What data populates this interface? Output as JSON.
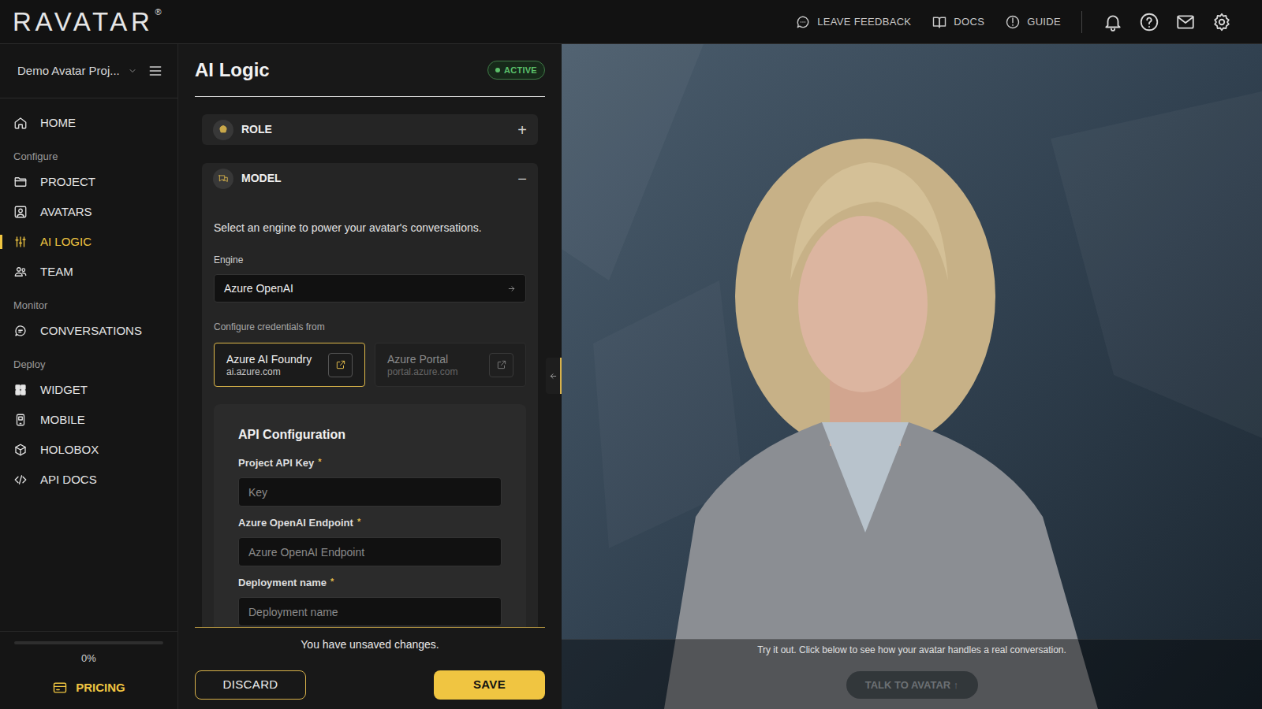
{
  "logo": {
    "text": "RAVATAR",
    "mark": "®"
  },
  "top_bar": {
    "links": [
      {
        "label": "LEAVE FEEDBACK"
      },
      {
        "label": "DOCS"
      },
      {
        "label": "GUIDE"
      }
    ]
  },
  "sidebar": {
    "project": "Demo Avatar Proj...",
    "nav": [
      {
        "kind": "link",
        "label": "HOME",
        "selected": false
      },
      {
        "kind": "heading",
        "label": "Configure"
      },
      {
        "kind": "link",
        "label": "PROJECT",
        "selected": false
      },
      {
        "kind": "link",
        "label": "AVATARS",
        "selected": false
      },
      {
        "kind": "link",
        "label": "AI LOGIC",
        "selected": true
      },
      {
        "kind": "link",
        "label": "TEAM",
        "selected": false
      },
      {
        "kind": "heading",
        "label": "Monitor"
      },
      {
        "kind": "link",
        "label": "CONVERSATIONS",
        "selected": false
      },
      {
        "kind": "heading",
        "label": "Deploy"
      },
      {
        "kind": "link",
        "label": "WIDGET",
        "selected": false
      },
      {
        "kind": "link",
        "label": "MOBILE",
        "selected": false
      },
      {
        "kind": "link",
        "label": "HOLOBOX",
        "selected": false
      },
      {
        "kind": "link",
        "label": "API DOCS",
        "selected": false
      }
    ],
    "progress": {
      "level": 0,
      "reading": "0%"
    },
    "pricing": "PRICING"
  },
  "panel": {
    "title": "AI Logic",
    "status": "ACTIVE",
    "sections": [
      {
        "title": "ROLE",
        "expanded": false,
        "toggle": "+"
      },
      {
        "title": "MODEL",
        "expanded": true,
        "toggle": "−"
      }
    ],
    "model": {
      "description": "Select an engine to power your avatar's conversations.",
      "engine_label": "Engine",
      "engine": "Azure OpenAI",
      "credentials_label": "Configure credentials from",
      "sources": [
        {
          "title": "Azure AI Foundry",
          "url": "ai.azure.com",
          "selected": true
        },
        {
          "title": "Azure Portal",
          "url": "portal.azure.com",
          "selected": false
        }
      ],
      "api_title": "API Configuration",
      "fields": [
        {
          "label": "Project API Key",
          "required": true,
          "mark": "*",
          "placeholder": "Key"
        },
        {
          "label": "Azure OpenAI Endpoint",
          "required": true,
          "mark": "*",
          "placeholder": "Azure OpenAI Endpoint"
        },
        {
          "label": "Deployment name",
          "required": true,
          "mark": "*",
          "placeholder": "Deployment name"
        }
      ]
    },
    "footer": {
      "notice": "You have unsaved changes.",
      "buttons": [
        {
          "label": "DISCARD",
          "kind": "secondary"
        },
        {
          "label": "SAVE",
          "kind": "primary"
        }
      ]
    }
  },
  "preview": {
    "hint": "Try it out. Click below to see how your avatar handles a real conversation.",
    "button": {
      "label": "TALK TO AVATAR ↑",
      "disabled": true
    }
  }
}
